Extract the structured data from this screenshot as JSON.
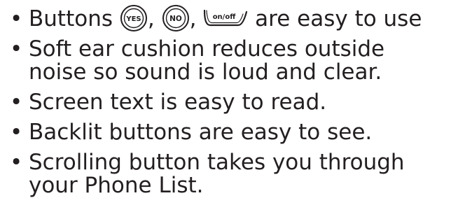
{
  "bullet_char": "•",
  "line1": {
    "before": "Buttons",
    "sep1": ",",
    "sep2": ",",
    "after": "are easy to use",
    "yes_button_label": "YES",
    "no_button_label": "NO",
    "onoff_button_label": "on/off"
  },
  "items": [
    {
      "line1": "Soft ear cushion reduces outside",
      "line2": "noise so sound is loud and clear."
    },
    {
      "line1": "Screen text is easy to read."
    },
    {
      "line1": "Backlit buttons are easy to see."
    },
    {
      "line1": "Scrolling button takes you through",
      "line2": "your Phone List."
    }
  ]
}
